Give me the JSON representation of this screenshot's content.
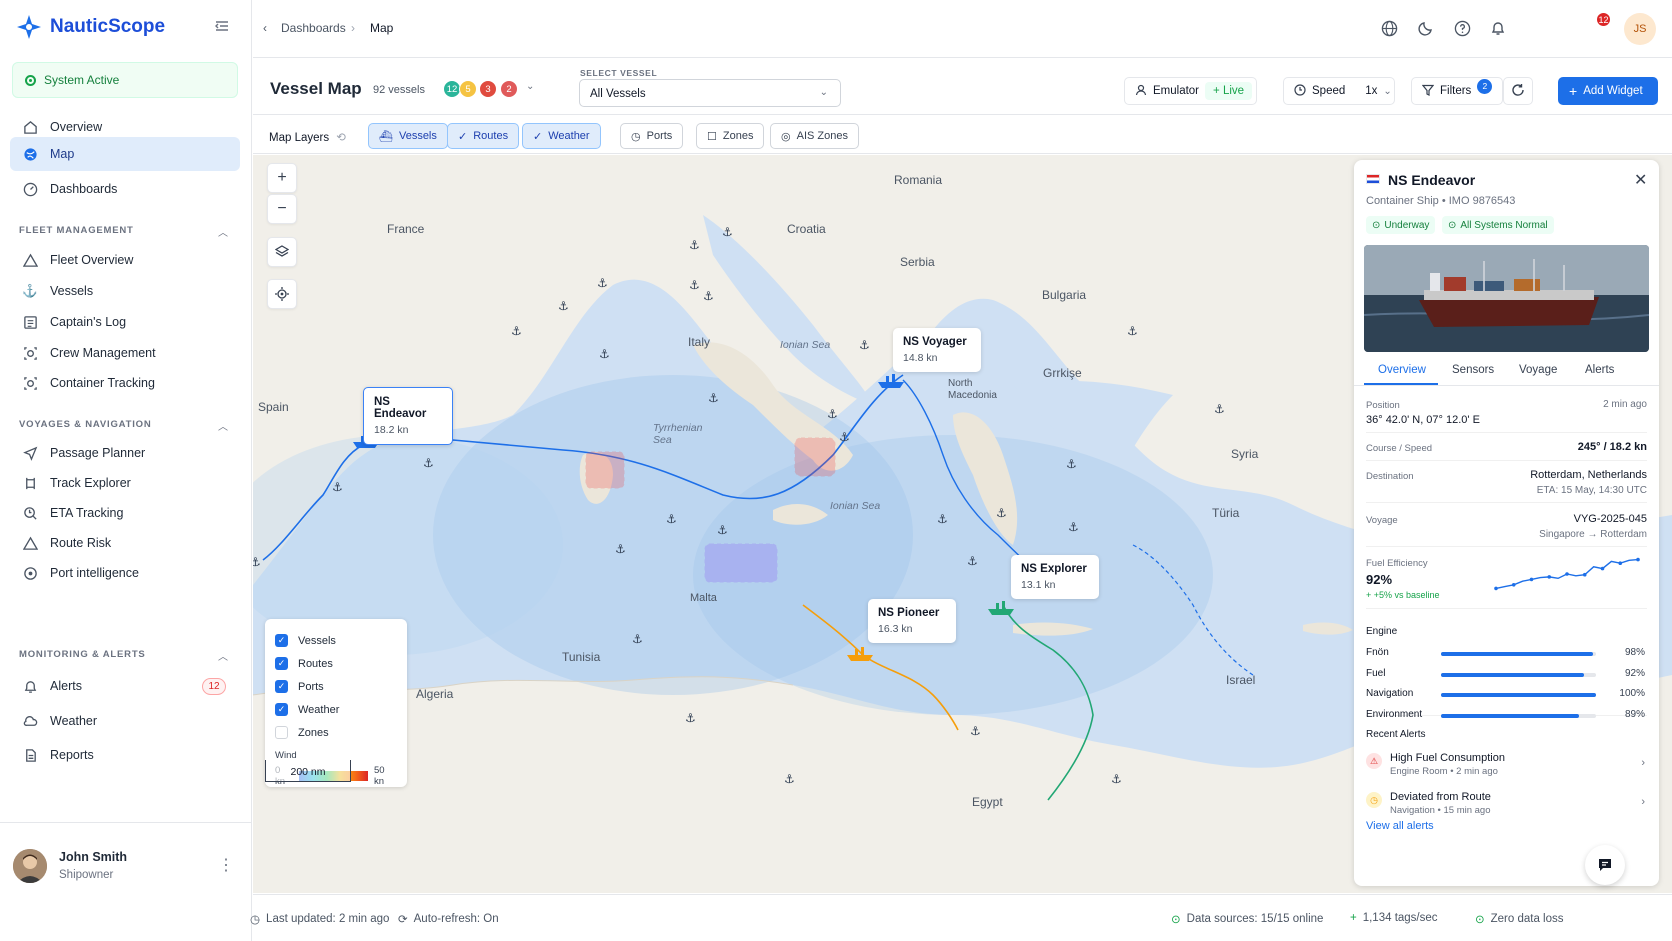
{
  "app": {
    "name": "NauticScope",
    "status": "System Active"
  },
  "nav": {
    "main": [
      {
        "label": "Overview"
      },
      {
        "label": "Map"
      },
      {
        "label": "Dashboards"
      }
    ],
    "fleet_title": "FLEET MANAGEMENT",
    "fleet": [
      {
        "label": "Fleet Overview"
      },
      {
        "label": "Vessels"
      },
      {
        "label": "Captain's Log"
      },
      {
        "label": "Crew Management"
      },
      {
        "label": "Container Tracking"
      }
    ],
    "voyage_title": "VOYAGES & NAVIGATION",
    "voyage": [
      {
        "label": "Passage Planner"
      },
      {
        "label": "Track Explorer"
      },
      {
        "label": "ETA Tracking"
      },
      {
        "label": "Route Risk"
      },
      {
        "label": "Port intelligence"
      }
    ],
    "monitor_title": "MONITORING & ALERTS",
    "monitor": [
      {
        "label": "Alerts",
        "badge": "12"
      },
      {
        "label": "Weather"
      },
      {
        "label": "Reports"
      }
    ]
  },
  "user": {
    "name": "John Smith",
    "role": "Shipowner",
    "initials": "JS"
  },
  "topbar": {
    "crumb1": "Dashboards",
    "crumb2": "Map",
    "notifications": "12"
  },
  "header": {
    "title": "Vessel Map",
    "vessel_count": "92 vessels",
    "status_pills": [
      {
        "value": "12",
        "color": "#2bb59a"
      },
      {
        "value": "5",
        "color": "#f5c342"
      },
      {
        "value": "3",
        "color": "#e04b3f"
      },
      {
        "value": "2",
        "color": "#e05a5a"
      }
    ],
    "select_label": "SELECT VESSEL",
    "select_value": "All Vessels",
    "emulator": "Emulator",
    "live": "Live",
    "speed": "Speed",
    "speed_value": "1x",
    "filters": "Filters",
    "filters_count": "2",
    "add_widget": "Add Widget"
  },
  "layers": {
    "label": "Map Layers",
    "chips": [
      {
        "label": "Vessels",
        "on": true
      },
      {
        "label": "Routes",
        "on": true
      },
      {
        "label": "Weather",
        "on": true
      },
      {
        "label": "Ports",
        "on": false
      },
      {
        "label": "Zones",
        "on": false
      },
      {
        "label": "AIS Zones",
        "on": false
      }
    ]
  },
  "map": {
    "places": [
      "Romania",
      "France",
      "Croatia",
      "Serbia",
      "Bulgaria",
      "Italy",
      "Ionian Sea",
      "North Macedonia",
      "Grrkişe",
      "Spain",
      "Tyrrhenian Sea",
      "Syria",
      "Ionian Sea",
      "Türia",
      "Malta",
      "Tunisia",
      "Algeria",
      "Israel",
      "Egypt"
    ],
    "vessels": [
      {
        "name": "NS Endeavor",
        "speed": "18.2 kn"
      },
      {
        "name": "NS Voyager",
        "speed": "14.8 kn"
      },
      {
        "name": "NS Explorer",
        "speed": "13.1 kn"
      },
      {
        "name": "NS Pioneer",
        "speed": "16.3 kn"
      }
    ],
    "legend": [
      {
        "label": "Vessels",
        "checked": true
      },
      {
        "label": "Routes",
        "checked": true
      },
      {
        "label": "Ports",
        "checked": true
      },
      {
        "label": "Weather",
        "checked": true
      },
      {
        "label": "Zones",
        "checked": false
      }
    ],
    "wind_label": "Wind",
    "wind_min": "0 kn",
    "wind_max": "50 kn",
    "scale": "200 nm"
  },
  "panel": {
    "vessel": "NS Endeavor",
    "type": "Container Ship",
    "imo": "IMO 9876543",
    "tags": [
      "Underway",
      "All Systems Normal"
    ],
    "tabs": [
      "Overview",
      "Sensors",
      "Voyage",
      "Alerts"
    ],
    "position_label": "Position",
    "position_time": "2 min ago",
    "position": "36° 42.0' N, 07° 12.0' E",
    "course_label": "Course / Speed",
    "course": "245° / 18.2 kn",
    "dest_label": "Destination",
    "dest": "Rotterdam, Netherlands",
    "eta": "ETA: 15 May, 14:30 UTC",
    "voyage_label": "Voyage",
    "voyage": "VYG-2025-045",
    "voyage_route": "Singapore → Rotterdam",
    "fuel_label": "Fuel Efficiency",
    "fuel_value": "92%",
    "fuel_delta": "+ +5% vs baseline",
    "fuel_trend": [
      0.1,
      0.15,
      0.2,
      0.3,
      0.35,
      0.4,
      0.42,
      0.38,
      0.5,
      0.45,
      0.48,
      0.7,
      0.65,
      0.85,
      0.8,
      0.88,
      0.9
    ],
    "engine_title": "Engine",
    "engine": [
      {
        "label": "Fnön",
        "value": 98,
        "pct": "98%"
      },
      {
        "label": "Fuel",
        "value": 92,
        "pct": "92%"
      },
      {
        "label": "Navigation",
        "value": 100,
        "pct": "100%"
      },
      {
        "label": "Environment",
        "value": 89,
        "pct": "89%"
      }
    ],
    "alerts_title": "Recent Alerts",
    "alerts": [
      {
        "title": "High Fuel Consumption",
        "meta": "Engine Room  •  2 min ago",
        "color": "#dc2626"
      },
      {
        "title": "Deviated from Route",
        "meta": "Navigation  •  15 min ago",
        "color": "#f59e0b"
      }
    ],
    "view_all": "View all alerts"
  },
  "footer": {
    "updated": "Last updated: 2 min ago",
    "refresh": "Auto-refresh: On",
    "sources": "Data sources: 15/15 online",
    "tags": "1,134 tags/sec",
    "loss": "Zero data loss"
  }
}
